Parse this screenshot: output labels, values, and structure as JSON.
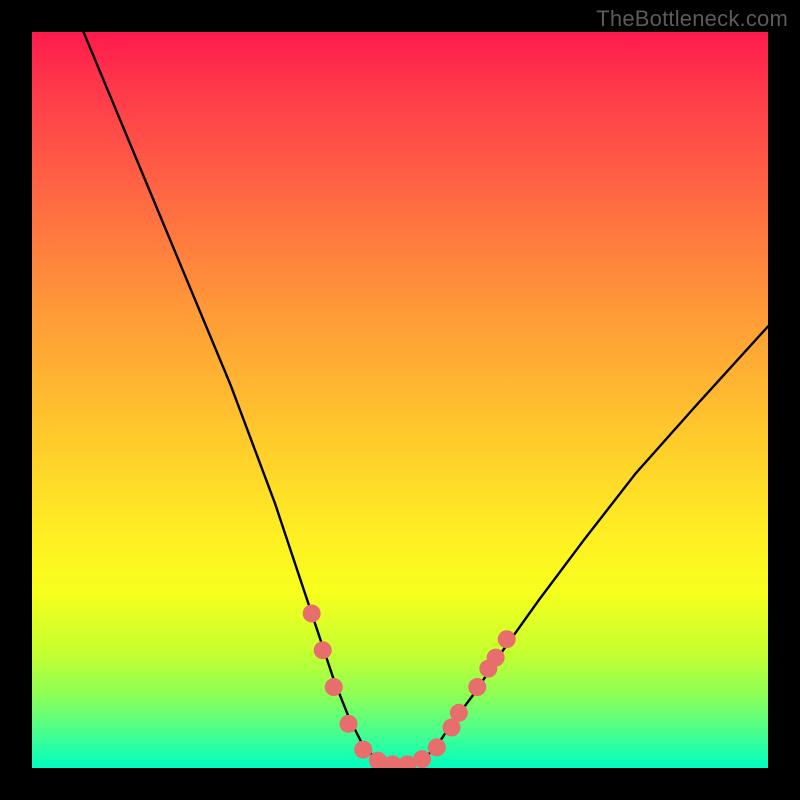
{
  "watermark": {
    "text": "TheBottleneck.com"
  },
  "chart_data": {
    "type": "line",
    "title": "",
    "xlabel": "",
    "ylabel": "",
    "xlim": [
      0,
      100
    ],
    "ylim": [
      0,
      100
    ],
    "grid": false,
    "legend": false,
    "series": [
      {
        "name": "curve",
        "color": "#000000",
        "x": [
          7,
          12,
          17,
          22,
          27,
          30,
          33,
          35,
          37,
          39,
          41,
          43,
          45,
          47,
          49,
          51,
          53,
          55,
          57,
          60,
          64,
          69,
          75,
          82,
          90,
          100
        ],
        "y": [
          100,
          88,
          76,
          64,
          52,
          44,
          36,
          30,
          24,
          18,
          12,
          7,
          3,
          1,
          0,
          0,
          1,
          3,
          6,
          10,
          16,
          23,
          31,
          40,
          49,
          60
        ]
      }
    ],
    "markers": {
      "name": "highlight-points",
      "color": "#e86d6d",
      "x": [
        38,
        39.5,
        41,
        43,
        45,
        47,
        49,
        51,
        53,
        55,
        57,
        58,
        60.5,
        62,
        63,
        64.5
      ],
      "y": [
        21,
        16,
        11,
        6,
        2.5,
        1,
        0.5,
        0.5,
        1.2,
        2.8,
        5.5,
        7.5,
        11,
        13.5,
        15,
        17.5
      ]
    },
    "background_gradient": {
      "stops": [
        {
          "pos": 0,
          "color": "#ff1a4d"
        },
        {
          "pos": 8,
          "color": "#ff3a4a"
        },
        {
          "pos": 18,
          "color": "#ff5a45"
        },
        {
          "pos": 28,
          "color": "#ff7a3f"
        },
        {
          "pos": 38,
          "color": "#ff9a38"
        },
        {
          "pos": 48,
          "color": "#ffb631"
        },
        {
          "pos": 58,
          "color": "#ffd22a"
        },
        {
          "pos": 68,
          "color": "#ffee23"
        },
        {
          "pos": 76,
          "color": "#f7ff1d"
        },
        {
          "pos": 84,
          "color": "#c8ff2e"
        },
        {
          "pos": 90,
          "color": "#8eff55"
        },
        {
          "pos": 95,
          "color": "#4aff8c"
        },
        {
          "pos": 100,
          "color": "#00ffc0"
        }
      ]
    }
  }
}
